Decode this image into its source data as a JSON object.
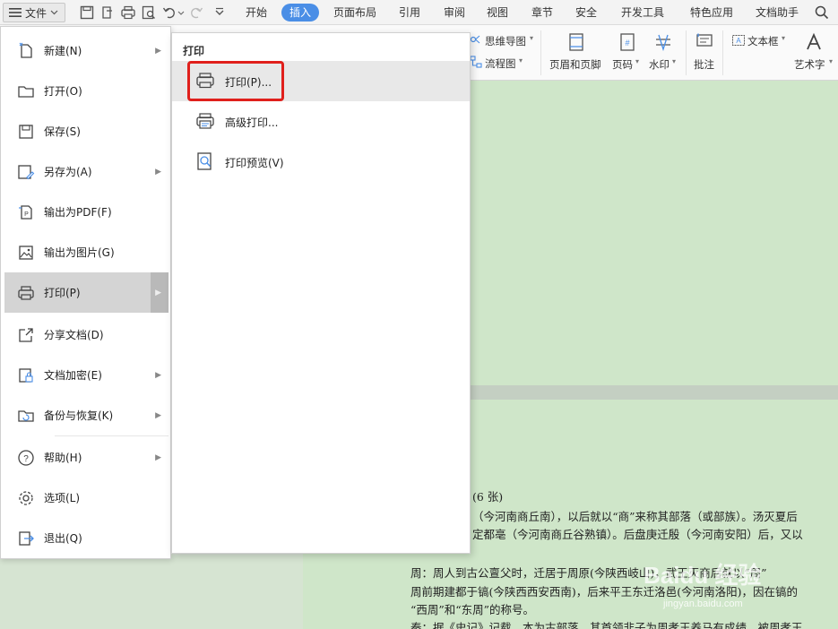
{
  "toolbar": {
    "file_label": "文件",
    "tabs": [
      "开始",
      "插入",
      "页面布局",
      "引用",
      "审阅",
      "视图",
      "章节",
      "安全",
      "开发工具",
      "特色应用",
      "文档助手"
    ],
    "active_tab": "插入"
  },
  "ribbon": {
    "mindmap": "思维导图",
    "flowchart": "流程图",
    "header_footer": "页眉和页脚",
    "page_number": "页码",
    "watermark": "水印",
    "comment": "批注",
    "textbox": "文本框",
    "wordart": "艺术字"
  },
  "file_menu": {
    "items": [
      {
        "label": "新建(N)",
        "icon": "new-file-icon",
        "has_submenu": true
      },
      {
        "label": "打开(O)",
        "icon": "folder-open-icon",
        "has_submenu": false
      },
      {
        "label": "保存(S)",
        "icon": "save-icon",
        "has_submenu": false
      },
      {
        "label": "另存为(A)",
        "icon": "save-as-icon",
        "has_submenu": true
      },
      {
        "label": "输出为PDF(F)",
        "icon": "pdf-export-icon",
        "has_submenu": false
      },
      {
        "label": "输出为图片(G)",
        "icon": "image-export-icon",
        "has_submenu": false
      },
      {
        "label": "打印(P)",
        "icon": "printer-icon",
        "has_submenu": true,
        "selected": true
      },
      {
        "label": "分享文档(D)",
        "icon": "share-icon",
        "has_submenu": false
      },
      {
        "label": "文档加密(E)",
        "icon": "lock-icon",
        "has_submenu": true
      },
      {
        "label": "备份与恢复(K)",
        "icon": "backup-icon",
        "has_submenu": true
      },
      {
        "label": "帮助(H)",
        "icon": "help-icon",
        "has_submenu": true
      },
      {
        "label": "选项(L)",
        "icon": "gear-icon",
        "has_submenu": false
      },
      {
        "label": "退出(Q)",
        "icon": "exit-icon",
        "has_submenu": false
      }
    ]
  },
  "print_submenu": {
    "title": "打印",
    "items": [
      {
        "label": "打印(P)...",
        "icon": "printer-icon",
        "highlighted": true
      },
      {
        "label": "高级打印...",
        "icon": "advanced-print-icon"
      },
      {
        "label": "打印预览(V)",
        "icon": "print-preview-icon"
      }
    ]
  },
  "document": {
    "lines": [
      "(6 张)",
      "（今河南商丘南），以后就以“商”来称其部落（或部族）。汤灭夏后",
      "定都亳（今河南商丘谷熟镇）。后盘庚迁殷（今河南安阳）后，又以",
      "周：周人到古公亶父时，迁居于周原(今陕西岐山)，武王灭商后就以“周”",
      "周前期建都于镐(今陕西西安西南)，后来平王东迁洛邑(今河南洛阳)，因在镐的",
      "“西周”和“东周”的称号。",
      "秦：据《史记》记载，本为古部落，其首领非子为周孝王养马有成绩，被周孝王"
    ]
  },
  "watermark_text": "Baidu 经验",
  "watermark_url": "jingyan.baidu.com"
}
